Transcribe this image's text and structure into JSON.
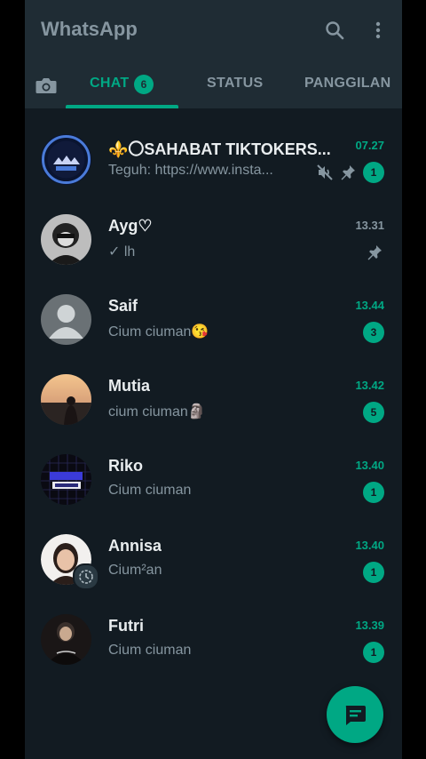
{
  "app": {
    "title": "WhatsApp"
  },
  "colors": {
    "accent": "#00a884",
    "background": "#121b22",
    "appbar": "#1f2c34",
    "muted": "#8696a0"
  },
  "icons": {
    "search": "search-icon",
    "menu": "more-vert-icon",
    "camera": "camera-icon",
    "new_chat": "new-chat-icon"
  },
  "tabs": {
    "chat": {
      "label": "CHAT",
      "badge": "6"
    },
    "status": {
      "label": "STATUS"
    },
    "calls": {
      "label": "PANGGILAN"
    }
  },
  "chats": [
    {
      "name": "⚜️〇SAHABAT TIKTOKERS...",
      "time": "07.27",
      "preview": "Teguh: https://www.insta...",
      "unread": "1",
      "muted": true,
      "pinned": true
    },
    {
      "name": "Ayg♡",
      "time": "13.31",
      "preview": "✓ lh",
      "pinned": true
    },
    {
      "name": "Saif",
      "time": "13.44",
      "preview": "Cium ciuman😘",
      "unread": "3"
    },
    {
      "name": "Mutia",
      "time": "13.42",
      "preview": "cium ciuman🗿",
      "unread": "5"
    },
    {
      "name": "Riko",
      "time": "13.40",
      "preview": "Cium ciuman",
      "unread": "1"
    },
    {
      "name": "Annisa",
      "time": "13.40",
      "preview": "Cium²an",
      "unread": "1"
    },
    {
      "name": "Futri",
      "time": "13.39",
      "preview": "Cium ciuman",
      "unread": "1"
    }
  ]
}
